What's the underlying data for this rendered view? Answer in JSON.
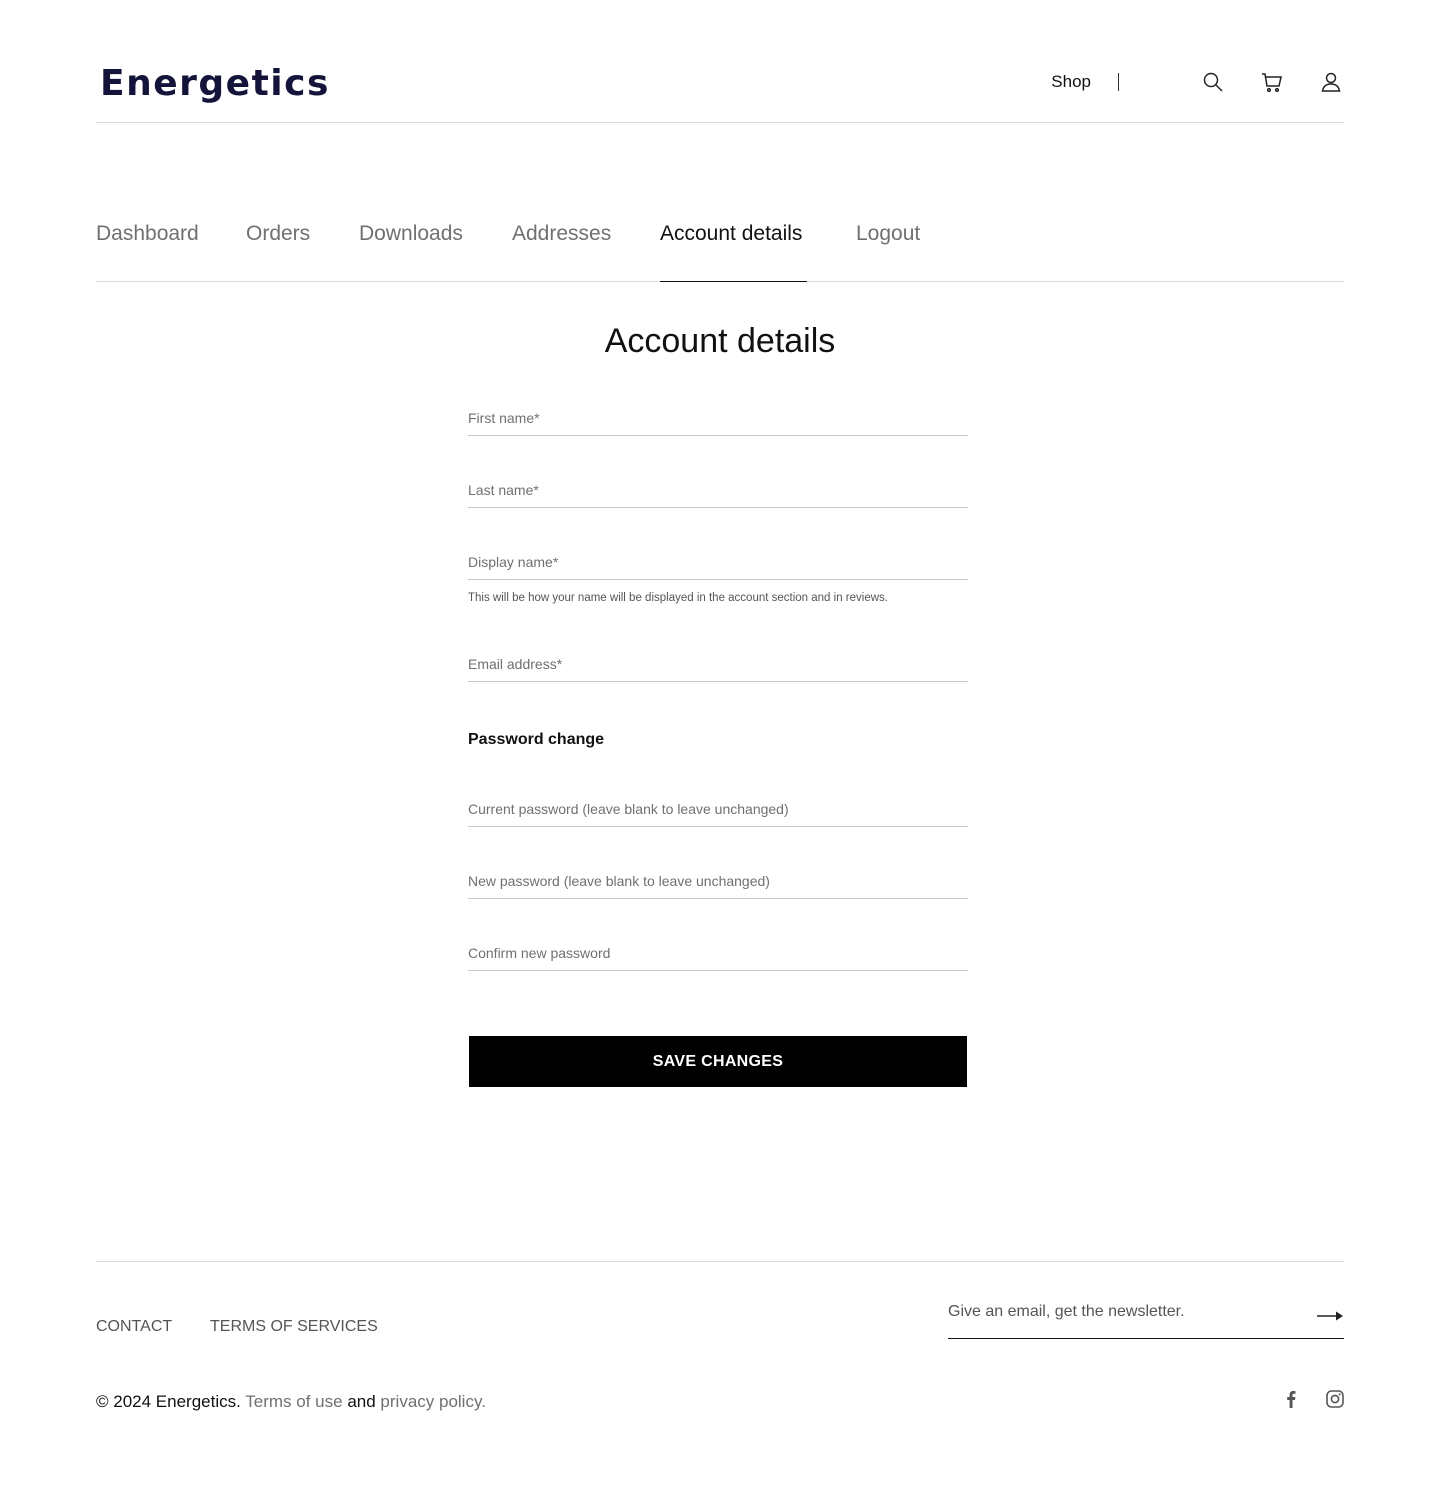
{
  "header": {
    "logo": "Energetics",
    "shop_label": "Shop",
    "icons": [
      "search-icon",
      "cart-icon",
      "user-icon"
    ]
  },
  "tabs": [
    {
      "label": "Dashboard",
      "active": false
    },
    {
      "label": "Orders",
      "active": false
    },
    {
      "label": "Downloads",
      "active": false
    },
    {
      "label": "Addresses",
      "active": false
    },
    {
      "label": "Account details",
      "active": true
    },
    {
      "label": "Logout",
      "active": false
    }
  ],
  "form": {
    "title": "Account details",
    "first_name": {
      "placeholder": "First name*",
      "value": ""
    },
    "last_name": {
      "placeholder": "Last name*",
      "value": ""
    },
    "display_name": {
      "placeholder": "Display name*",
      "value": "",
      "hint": "This will be how your name will be displayed in the account section and in reviews."
    },
    "email": {
      "placeholder": "Email address*",
      "value": ""
    },
    "password_section_title": "Password change",
    "current_password": {
      "placeholder": "Current password (leave blank to leave unchanged)",
      "value": ""
    },
    "new_password": {
      "placeholder": "New password (leave blank to leave unchanged)",
      "value": ""
    },
    "confirm_password": {
      "placeholder": "Confirm new password",
      "value": ""
    },
    "save_label": "SAVE CHANGES"
  },
  "footer": {
    "contact_label": "CONTACT",
    "terms_label": "TERMS OF SERVICES",
    "newsletter_placeholder": "Give an email, get the newsletter.",
    "copyright_prefix": "© 2024 Energetics.",
    "terms_of_use": "Terms of use",
    "and_text": "and",
    "privacy_policy": "privacy policy.",
    "social_icons": [
      "facebook-icon",
      "instagram-icon"
    ]
  }
}
